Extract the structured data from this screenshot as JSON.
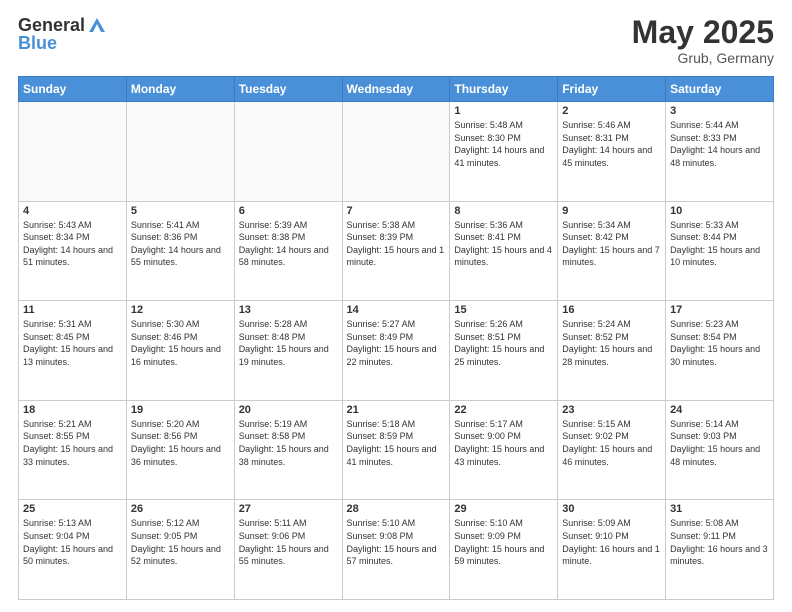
{
  "header": {
    "logo_general": "General",
    "logo_blue": "Blue",
    "title": "May 2025",
    "location": "Grub, Germany"
  },
  "days_of_week": [
    "Sunday",
    "Monday",
    "Tuesday",
    "Wednesday",
    "Thursday",
    "Friday",
    "Saturday"
  ],
  "weeks": [
    [
      {
        "day": "",
        "info": ""
      },
      {
        "day": "",
        "info": ""
      },
      {
        "day": "",
        "info": ""
      },
      {
        "day": "",
        "info": ""
      },
      {
        "day": "1",
        "info": "Sunrise: 5:48 AM\nSunset: 8:30 PM\nDaylight: 14 hours and 41 minutes."
      },
      {
        "day": "2",
        "info": "Sunrise: 5:46 AM\nSunset: 8:31 PM\nDaylight: 14 hours and 45 minutes."
      },
      {
        "day": "3",
        "info": "Sunrise: 5:44 AM\nSunset: 8:33 PM\nDaylight: 14 hours and 48 minutes."
      }
    ],
    [
      {
        "day": "4",
        "info": "Sunrise: 5:43 AM\nSunset: 8:34 PM\nDaylight: 14 hours and 51 minutes."
      },
      {
        "day": "5",
        "info": "Sunrise: 5:41 AM\nSunset: 8:36 PM\nDaylight: 14 hours and 55 minutes."
      },
      {
        "day": "6",
        "info": "Sunrise: 5:39 AM\nSunset: 8:38 PM\nDaylight: 14 hours and 58 minutes."
      },
      {
        "day": "7",
        "info": "Sunrise: 5:38 AM\nSunset: 8:39 PM\nDaylight: 15 hours and 1 minute."
      },
      {
        "day": "8",
        "info": "Sunrise: 5:36 AM\nSunset: 8:41 PM\nDaylight: 15 hours and 4 minutes."
      },
      {
        "day": "9",
        "info": "Sunrise: 5:34 AM\nSunset: 8:42 PM\nDaylight: 15 hours and 7 minutes."
      },
      {
        "day": "10",
        "info": "Sunrise: 5:33 AM\nSunset: 8:44 PM\nDaylight: 15 hours and 10 minutes."
      }
    ],
    [
      {
        "day": "11",
        "info": "Sunrise: 5:31 AM\nSunset: 8:45 PM\nDaylight: 15 hours and 13 minutes."
      },
      {
        "day": "12",
        "info": "Sunrise: 5:30 AM\nSunset: 8:46 PM\nDaylight: 15 hours and 16 minutes."
      },
      {
        "day": "13",
        "info": "Sunrise: 5:28 AM\nSunset: 8:48 PM\nDaylight: 15 hours and 19 minutes."
      },
      {
        "day": "14",
        "info": "Sunrise: 5:27 AM\nSunset: 8:49 PM\nDaylight: 15 hours and 22 minutes."
      },
      {
        "day": "15",
        "info": "Sunrise: 5:26 AM\nSunset: 8:51 PM\nDaylight: 15 hours and 25 minutes."
      },
      {
        "day": "16",
        "info": "Sunrise: 5:24 AM\nSunset: 8:52 PM\nDaylight: 15 hours and 28 minutes."
      },
      {
        "day": "17",
        "info": "Sunrise: 5:23 AM\nSunset: 8:54 PM\nDaylight: 15 hours and 30 minutes."
      }
    ],
    [
      {
        "day": "18",
        "info": "Sunrise: 5:21 AM\nSunset: 8:55 PM\nDaylight: 15 hours and 33 minutes."
      },
      {
        "day": "19",
        "info": "Sunrise: 5:20 AM\nSunset: 8:56 PM\nDaylight: 15 hours and 36 minutes."
      },
      {
        "day": "20",
        "info": "Sunrise: 5:19 AM\nSunset: 8:58 PM\nDaylight: 15 hours and 38 minutes."
      },
      {
        "day": "21",
        "info": "Sunrise: 5:18 AM\nSunset: 8:59 PM\nDaylight: 15 hours and 41 minutes."
      },
      {
        "day": "22",
        "info": "Sunrise: 5:17 AM\nSunset: 9:00 PM\nDaylight: 15 hours and 43 minutes."
      },
      {
        "day": "23",
        "info": "Sunrise: 5:15 AM\nSunset: 9:02 PM\nDaylight: 15 hours and 46 minutes."
      },
      {
        "day": "24",
        "info": "Sunrise: 5:14 AM\nSunset: 9:03 PM\nDaylight: 15 hours and 48 minutes."
      }
    ],
    [
      {
        "day": "25",
        "info": "Sunrise: 5:13 AM\nSunset: 9:04 PM\nDaylight: 15 hours and 50 minutes."
      },
      {
        "day": "26",
        "info": "Sunrise: 5:12 AM\nSunset: 9:05 PM\nDaylight: 15 hours and 52 minutes."
      },
      {
        "day": "27",
        "info": "Sunrise: 5:11 AM\nSunset: 9:06 PM\nDaylight: 15 hours and 55 minutes."
      },
      {
        "day": "28",
        "info": "Sunrise: 5:10 AM\nSunset: 9:08 PM\nDaylight: 15 hours and 57 minutes."
      },
      {
        "day": "29",
        "info": "Sunrise: 5:10 AM\nSunset: 9:09 PM\nDaylight: 15 hours and 59 minutes."
      },
      {
        "day": "30",
        "info": "Sunrise: 5:09 AM\nSunset: 9:10 PM\nDaylight: 16 hours and 1 minute."
      },
      {
        "day": "31",
        "info": "Sunrise: 5:08 AM\nSunset: 9:11 PM\nDaylight: 16 hours and 3 minutes."
      }
    ]
  ]
}
